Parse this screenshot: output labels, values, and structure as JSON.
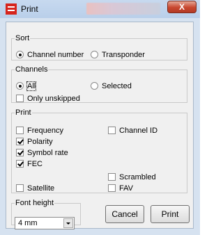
{
  "window": {
    "title": "Print",
    "close_symbol": "X"
  },
  "sort": {
    "legend": "Sort",
    "options": [
      {
        "label": "Channel number",
        "checked": true
      },
      {
        "label": "Transponder",
        "checked": false
      }
    ]
  },
  "channels": {
    "legend": "Channels",
    "all_label": "All",
    "all_checked": true,
    "selected_label": "Selected",
    "selected_checked": false,
    "only_unskipped_label": "Only unskipped",
    "only_unskipped_checked": false
  },
  "print": {
    "legend": "Print",
    "frequency_label": "Frequency",
    "polarity_label": "Polarity",
    "symbol_rate_label": "Symbol rate",
    "fec_label": "FEC",
    "satellite_label": "Satellite",
    "channel_id_label": "Channel ID",
    "scrambled_label": "Scrambled",
    "fav_label": "FAV",
    "checked": {
      "frequency": false,
      "polarity": true,
      "symbol_rate": true,
      "fec": true,
      "satellite": false,
      "channel_id": false,
      "scrambled": false,
      "fav": false
    }
  },
  "font_height": {
    "legend": "Font height",
    "value": "4 mm"
  },
  "buttons": {
    "cancel": "Cancel",
    "print": "Print"
  }
}
